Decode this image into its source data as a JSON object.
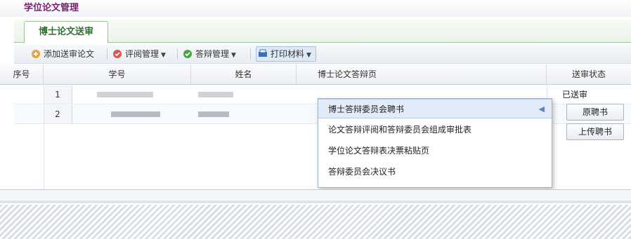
{
  "app": {
    "title": "学位论文管理"
  },
  "tabs": [
    {
      "label": "博士论文送审",
      "active": true
    }
  ],
  "toolbar": {
    "items": [
      {
        "label": "添加送审论文",
        "icon": "add-icon",
        "dropdown": false
      },
      {
        "label": "评阅管理",
        "icon": "review-icon",
        "dropdown": true
      },
      {
        "label": "答辩管理",
        "icon": "defense-icon",
        "dropdown": true
      },
      {
        "label": "打印材料",
        "icon": "print-icon",
        "dropdown": true
      }
    ]
  },
  "grid": {
    "columns": [
      "序号",
      "学号",
      "姓名",
      "博士论文答辩页",
      "送审状态"
    ],
    "rows": [
      {
        "num": "1",
        "status": "已送审"
      },
      {
        "num": "2",
        "status": ""
      }
    ],
    "row_buttons": [
      "原聘书",
      "上传聘书"
    ]
  },
  "print_menu": {
    "items": [
      {
        "label": "博士答辩委员会聘书",
        "highlighted": true
      },
      {
        "label": "论文答辩评阅和答辩委员会组成审批表",
        "highlighted": false
      },
      {
        "label": "学位论文答辩表决票粘贴页",
        "highlighted": false
      },
      {
        "label": "答辩委员会决议书",
        "highlighted": false
      }
    ]
  },
  "colors": {
    "title": "#7a1e6e",
    "tab_text": "#2f6e2f",
    "highlight": "#e2ecf8"
  }
}
